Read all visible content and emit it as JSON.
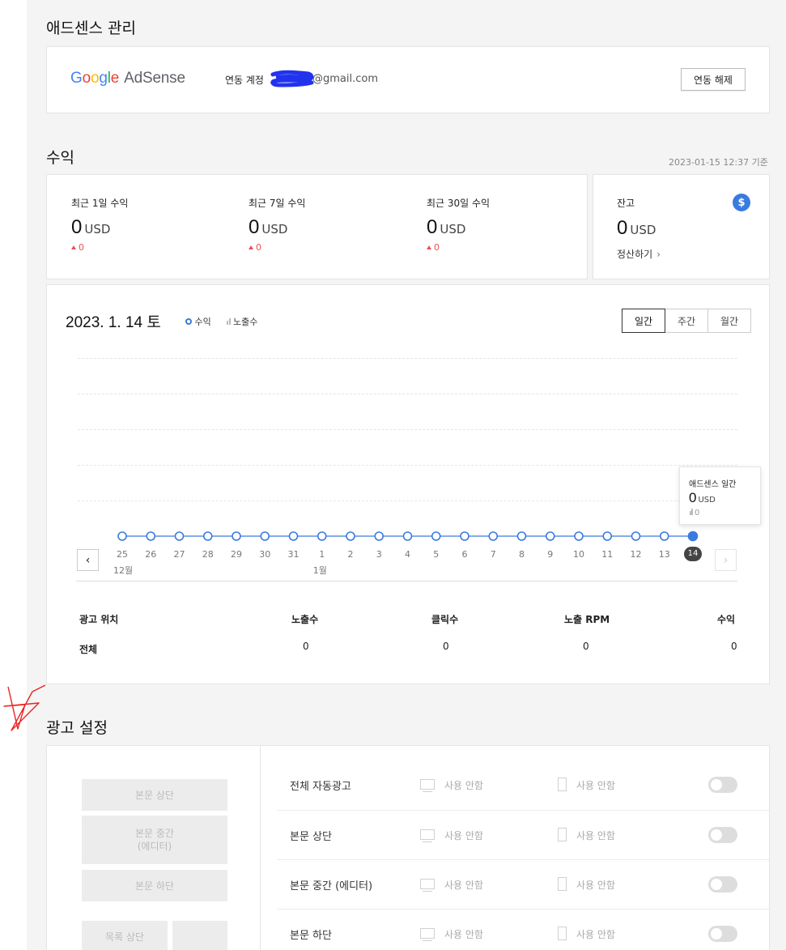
{
  "adsense_section": {
    "title": "애드센스 관리",
    "logo": {
      "google": "Google",
      "product": "AdSense"
    },
    "account_label": "연동 계정",
    "account_email": "@gmail.com",
    "unlink_button": "연동 해제"
  },
  "revenue": {
    "title": "수익",
    "timestamp": "2023-01-15 12:37 기준",
    "stats": [
      {
        "label": "최근 1일 수익",
        "value": "0",
        "unit": "USD",
        "delta": "0"
      },
      {
        "label": "최근 7일 수익",
        "value": "0",
        "unit": "USD",
        "delta": "0"
      },
      {
        "label": "최근 30일 수익",
        "value": "0",
        "unit": "USD",
        "delta": "0"
      }
    ],
    "balance": {
      "label": "잔고",
      "value": "0",
      "unit": "USD",
      "link": "정산하기",
      "icon": "dollar-icon"
    }
  },
  "chart_panel": {
    "date": "2023. 1. 14 토",
    "legend": {
      "revenue": "수익",
      "impressions": "노출수"
    },
    "period_tabs": [
      "일간",
      "주간",
      "월간"
    ],
    "active_tab": "일간",
    "tooltip": {
      "title": "애드센스 일간",
      "value": "0",
      "unit": "USD",
      "impressions": "0"
    }
  },
  "chart_data": {
    "type": "line",
    "x": [
      "25",
      "26",
      "27",
      "28",
      "29",
      "30",
      "31",
      "1",
      "2",
      "3",
      "4",
      "5",
      "6",
      "7",
      "8",
      "9",
      "10",
      "11",
      "12",
      "13",
      "14"
    ],
    "month_labels": [
      {
        "at": "25",
        "label": "12월"
      },
      {
        "at": "1",
        "label": "1월"
      }
    ],
    "series": [
      {
        "name": "수익",
        "values": [
          0,
          0,
          0,
          0,
          0,
          0,
          0,
          0,
          0,
          0,
          0,
          0,
          0,
          0,
          0,
          0,
          0,
          0,
          0,
          0,
          0
        ]
      }
    ],
    "selected": "14",
    "grid": true,
    "colors": {
      "line": "#3a7be0"
    }
  },
  "summary_table": {
    "headers": [
      "광고 위치",
      "노출수",
      "클릭수",
      "노출 RPM",
      "수익"
    ],
    "rows": [
      [
        "전체",
        "0",
        "0",
        "0",
        "0"
      ]
    ]
  },
  "ad_settings": {
    "title": "광고 설정",
    "slot_buttons": [
      "본문 상단",
      "본문 중간\n(에디터)",
      "본문 하단",
      "목록 상단",
      ""
    ],
    "rows": [
      {
        "label": "전체 자동광고",
        "pc": "사용 안함",
        "mobile": "사용 안함"
      },
      {
        "label": "본문 상단",
        "pc": "사용 안함",
        "mobile": "사용 안함"
      },
      {
        "label": "본문 중간 (에디터)",
        "pc": "사용 안함",
        "mobile": "사용 안함"
      },
      {
        "label": "본문 하단",
        "pc": "사용 안함",
        "mobile": "사용 안함"
      }
    ]
  }
}
